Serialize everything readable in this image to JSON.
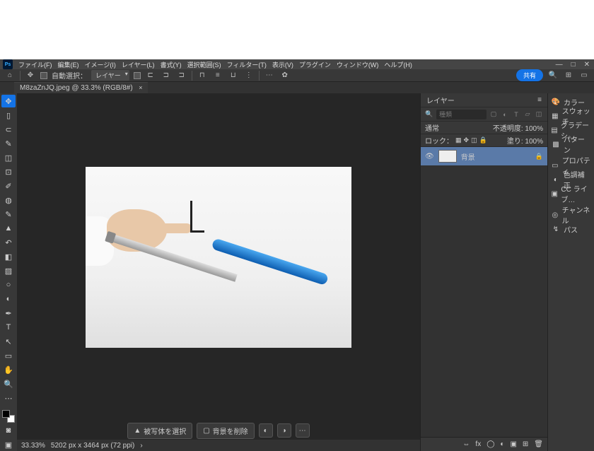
{
  "menu": {
    "items": [
      "ファイル(F)",
      "編集(E)",
      "イメージ(I)",
      "レイヤー(L)",
      "書式(Y)",
      "選択範囲(S)",
      "フィルター(T)",
      "表示(V)",
      "プラグイン",
      "ウィンドウ(W)",
      "ヘルプ(H)"
    ]
  },
  "optbar": {
    "auto_select": "自動選択：",
    "sample": "レイヤー",
    "share": "共有"
  },
  "tab": {
    "title": "M8zaZnJQ.jpeg @ 33.3% (RGB/8#)"
  },
  "ctx": {
    "select_subject": "被写体を選択",
    "remove_bg": "背景を削除"
  },
  "status": {
    "zoom": "33.33%",
    "dims": "5202 px x 3464 px (72 ppi)"
  },
  "layers": {
    "title": "レイヤー",
    "search_ph": "種類",
    "blend": "通常",
    "opacity_label": "不透明度",
    "opacity": "100%",
    "lock": "ロック：",
    "fill_label": "塗り",
    "fill": "100%",
    "layer_name": "背景"
  },
  "rstrip": {
    "items": [
      "カラー",
      "スウォッチ",
      "グラデーシ…",
      "パターン",
      "プロパティ",
      "色調補正",
      "CC ライブ…",
      "チャンネル",
      "パス"
    ]
  }
}
